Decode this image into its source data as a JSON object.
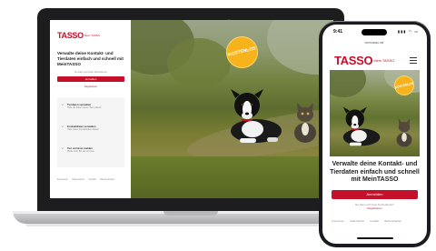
{
  "brand": {
    "name": "TASSO",
    "sub": "Mein TASSO",
    "accent": "#c5102b",
    "badge_color": "#f6b31b"
  },
  "laptop": {
    "headline": "Verwalte deine Kontakt- und Tierdaten einfach und schnell mit MeinTASSO",
    "register_hint": "Du hast noch kein Nutzerkonto",
    "login_button": "Anmelden",
    "register_link": "Registrieren",
    "features": [
      {
        "title": "Tierdaten verwalten",
        "desc": "Halte die Daten deiner Tiere aktuell"
      },
      {
        "title": "Kontaktdaten verwalten",
        "desc": "Halte deine Kontaktdaten aktuell"
      },
      {
        "title": "Tier vermisst melden",
        "desc": "Melde dein Tier als vermisst"
      }
    ],
    "footer": [
      "Impressum",
      "Datenschutz",
      "Kontakt",
      "Barrierefreiheit"
    ],
    "badge": "KOSTENLOS"
  },
  "phone": {
    "time": "9:41",
    "status_icons": "▮▮▮ ◠ ▭",
    "url": "mein.tasso.net",
    "headline": "Verwalte deine Kontakt- und Tierdaten einfach und schnell mit MeinTASSO",
    "login_button": "Anmelden",
    "register_hint": "Du hast noch kein Nutzerkonto?",
    "register_link": "Registrieren",
    "footer": "Impressum · Datenschutz · Kontakt · Barrierefreiheit",
    "badge": "KOSTENLOS"
  }
}
